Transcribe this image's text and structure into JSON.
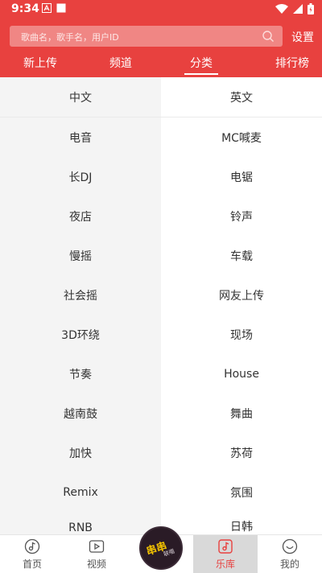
{
  "status": {
    "time": "9:34"
  },
  "search": {
    "placeholder": "歌曲名，歌手名，用户ID"
  },
  "header": {
    "settings_label": "设置"
  },
  "tabs": [
    {
      "label": "新上传"
    },
    {
      "label": "频道"
    },
    {
      "label": "分类",
      "active": true
    },
    {
      "label": "排行榜"
    }
  ],
  "categories": [
    [
      "中文",
      "英文"
    ],
    [
      "电音",
      "MC喊麦"
    ],
    [
      "长DJ",
      "电锯"
    ],
    [
      "夜店",
      "铃声"
    ],
    [
      "慢摇",
      "车载"
    ],
    [
      "社会摇",
      "网友上传"
    ],
    [
      "3D环绕",
      "现场"
    ],
    [
      "节奏",
      "House"
    ],
    [
      "越南鼓",
      "舞曲"
    ],
    [
      "加快",
      "苏荷"
    ],
    [
      "Remix",
      "氛围"
    ],
    [
      "RNB",
      "日韩"
    ]
  ],
  "bottom_nav": [
    {
      "label": "首页",
      "icon": "music-note-icon"
    },
    {
      "label": "视频",
      "icon": "video-play-icon"
    },
    {
      "label": "乐库",
      "icon": "library-icon",
      "active": true
    },
    {
      "label": "我的",
      "icon": "smile-face-icon"
    }
  ],
  "center_disc": {
    "text": "串串",
    "subtext": "联唱"
  },
  "colors": {
    "accent": "#e8413f"
  }
}
